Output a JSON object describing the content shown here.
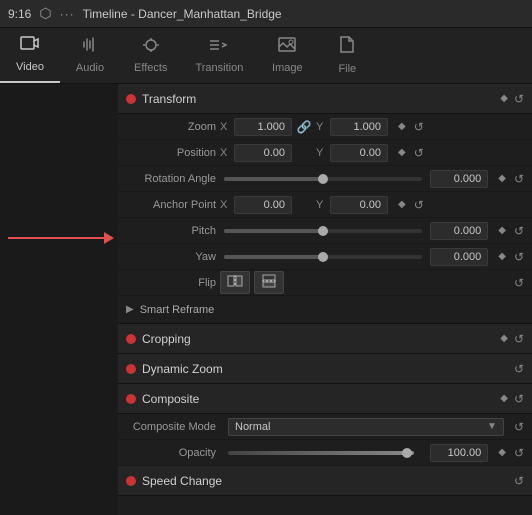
{
  "topbar": {
    "time": "9:16",
    "title": "Timeline - Dancer_Manhattan_Bridge",
    "dots_label": "..."
  },
  "tabs": {
    "items": [
      {
        "id": "video",
        "label": "Video",
        "icon": "▦",
        "active": true
      },
      {
        "id": "audio",
        "label": "Audio",
        "icon": "♪"
      },
      {
        "id": "effects",
        "label": "Effects",
        "icon": "✦"
      },
      {
        "id": "transition",
        "label": "Transition",
        "icon": "⇄"
      },
      {
        "id": "image",
        "label": "Image",
        "icon": "⬜"
      },
      {
        "id": "file",
        "label": "File",
        "icon": "📄"
      }
    ]
  },
  "panel": {
    "transform": {
      "label": "Transform",
      "zoom": {
        "x": "1.000",
        "y": "1.000"
      },
      "position": {
        "x": "0.00",
        "y": "0.00"
      },
      "rotation_angle": {
        "value": "0.000",
        "slider_pct": 50
      },
      "anchor_point": {
        "x": "0.00",
        "y": "0.00"
      },
      "pitch": {
        "value": "0.000",
        "slider_pct": 50
      },
      "yaw": {
        "value": "0.000",
        "slider_pct": 50
      },
      "flip_h_label": "↔",
      "flip_v_label": "↕"
    },
    "smart_reframe": {
      "label": "Smart Reframe"
    },
    "cropping": {
      "label": "Cropping"
    },
    "dynamic_zoom": {
      "label": "Dynamic Zoom"
    },
    "composite": {
      "label": "Composite",
      "mode_label": "Composite Mode",
      "mode_value": "Normal",
      "opacity_label": "Opacity",
      "opacity_value": "100.00"
    },
    "speed_change": {
      "label": "Speed Change"
    }
  },
  "labels": {
    "zoom": "Zoom",
    "position": "Position",
    "rotation_angle": "Rotation Angle",
    "anchor_point": "Anchor Point",
    "pitch": "Pitch",
    "yaw": "Yaw",
    "flip": "Flip",
    "x": "X",
    "y": "Y"
  },
  "colors": {
    "accent_red": "#cc3333",
    "arrow_red": "#e05050",
    "active_tab_line": "#c8c8c8",
    "panel_bg": "#1e1e1e",
    "section_bg": "#252525"
  }
}
